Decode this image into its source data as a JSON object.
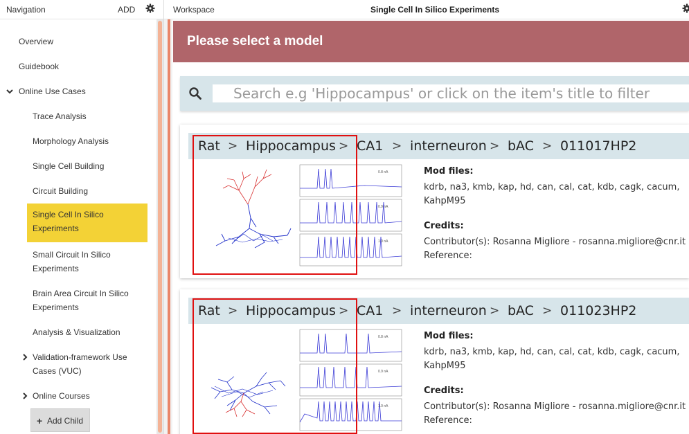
{
  "nav": {
    "title": "Navigation",
    "add_label": "ADD",
    "items": [
      {
        "label": "Overview"
      },
      {
        "label": "Guidebook"
      },
      {
        "label": "Online Use Cases"
      },
      {
        "label": "Trace Analysis"
      },
      {
        "label": "Morphology Analysis"
      },
      {
        "label": "Single Cell Building"
      },
      {
        "label": "Circuit Building"
      },
      {
        "label": "Single Cell In Silico",
        "label2": "Experiments"
      },
      {
        "label": "Small Circuit In Silico",
        "label2": "Experiments"
      },
      {
        "label": "Brain Area Circuit In Silico",
        "label2": "Experiments"
      },
      {
        "label": "Analysis & Visualization"
      },
      {
        "label": "Validation-framework Use",
        "label2": "Cases (VUC)"
      },
      {
        "label": "Online Courses"
      }
    ],
    "add_child_label": "Add Child",
    "active_color": "#f3d236"
  },
  "workspace": {
    "label": "Workspace",
    "title": "Single Cell In Silico Experiments"
  },
  "banner": {
    "text": "Please select a model",
    "color": "#b0656a"
  },
  "search": {
    "placeholder": "Search e.g 'Hippocampus' or click on the item's title to filter"
  },
  "models": [
    {
      "crumbs": [
        "Rat",
        "Hippocampus",
        "CA1",
        "interneuron",
        "bAC",
        "011017HP2"
      ],
      "mod_files_label": "Mod files:",
      "mod_files_line1": "kdrb, na3, kmb, kap, hd, can, cal, cat, kdb, cagk, cacum,",
      "mod_files_line2": "KahpM95",
      "credits_label": "Credits:",
      "contributors": "Contributor(s): Rosanna Migliore - rosanna.migliore@cnr.it",
      "reference": "Reference:",
      "trace_labels": [
        "0.8 nA",
        "0.9 nA",
        "1.0 nA"
      ]
    },
    {
      "crumbs": [
        "Rat",
        "Hippocampus",
        "CA1",
        "interneuron",
        "bAC",
        "011023HP2"
      ],
      "mod_files_label": "Mod files:",
      "mod_files_line1": "kdrb, na3, kmb, kap, hd, can, cal, cat, kdb, cagk, cacum,",
      "mod_files_line2": "KahpM95",
      "credits_label": "Credits:",
      "contributors": "Contributor(s): Rosanna Migliore - rosanna.migliore@cnr.it",
      "reference": "Reference:",
      "trace_labels": [
        "0.8 nA",
        "0.9 nA",
        "1.0 nA"
      ]
    }
  ],
  "crumb_separator": ">",
  "colors": {
    "title_bar": "#d7e5ea",
    "highlight_box": "#e01010",
    "trace": "#3b3bd6",
    "dendrite_red": "#d83030",
    "dendrite_blue": "#1f2fc9"
  },
  "icons": [
    "gear-icon",
    "search-icon",
    "chevron-down-icon",
    "chevron-right-icon",
    "plus-icon"
  ]
}
